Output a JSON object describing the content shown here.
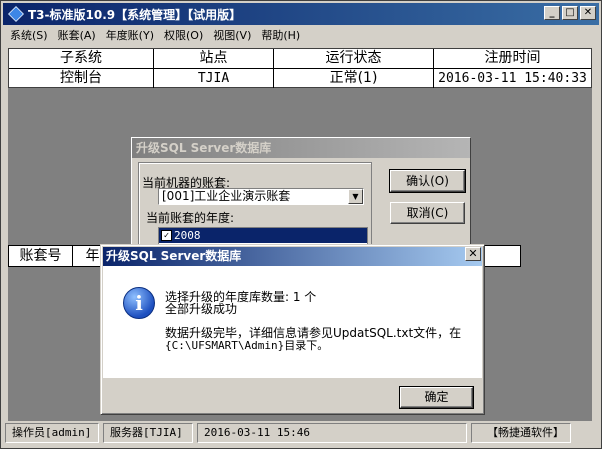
{
  "window": {
    "title": "T3-标准版10.9【系统管理】【试用版】"
  },
  "menu": [
    "系统(S)",
    "账套(A)",
    "年度账(Y)",
    "权限(O)",
    "视图(V)",
    "帮助(H)"
  ],
  "main_grid": {
    "headers": [
      "子系统",
      "站点",
      "运行状态",
      "注册时间"
    ],
    "rows": [
      [
        "控制台",
        "TJIA",
        "正常(1)",
        "2016-03-11 15:40:33"
      ]
    ]
  },
  "second_grid": {
    "headers": [
      "账套号",
      "年"
    ]
  },
  "upgrade_dialog": {
    "title": "升级SQL Server数据库",
    "account_label": "当前机器的账套:",
    "account_value": "[001]工业企业演示账套",
    "year_label": "当前账套的年度:",
    "year_item": "2008",
    "ok_label": "确认(O)",
    "cancel_label": "取消(C)"
  },
  "msgbox": {
    "title": "升级SQL Server数据库",
    "line1": "选择升级的年度库数量: 1 个",
    "line2": "全部升级成功",
    "line3": "数据升级完毕，详细信息请参见UpdatSQL.txt文件，在",
    "line4": "{C:\\UFSMART\\Admin}目录下。",
    "ok_label": "确定",
    "icon": "info-icon"
  },
  "statusbar": {
    "operator": "操作员[admin]",
    "server": "服务器[TJIA]",
    "datetime": "2016-03-11 15:46",
    "brand": "【畅捷通软件】"
  }
}
